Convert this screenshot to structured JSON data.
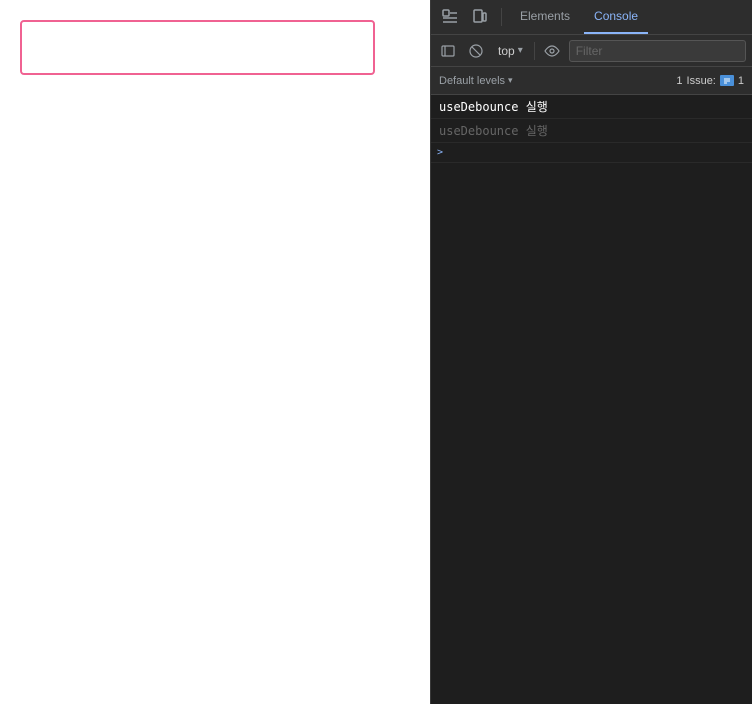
{
  "page": {
    "search_box_placeholder": ""
  },
  "devtools": {
    "tabs": [
      {
        "id": "elements",
        "label": "Elements",
        "active": false
      },
      {
        "id": "console",
        "label": "Console",
        "active": true
      }
    ],
    "toolbar": {
      "context_label": "top",
      "filter_placeholder": "Filter",
      "default_levels_label": "Default levels",
      "issue_count": "1",
      "issue_label": "Issue:",
      "issue_number": "1"
    },
    "console_lines": [
      {
        "id": "line1",
        "text": "useDebounce 실행",
        "dim": false
      },
      {
        "id": "line2",
        "text": "useDebounce 실행",
        "dim": true
      },
      {
        "id": "line3",
        "text": ">",
        "expand": true
      }
    ]
  },
  "icons": {
    "inspect": "⬚",
    "device": "□",
    "chevron_down": "▾",
    "eye": "◉",
    "ban": "⊘",
    "sidebar": "▤",
    "expand": ">"
  }
}
